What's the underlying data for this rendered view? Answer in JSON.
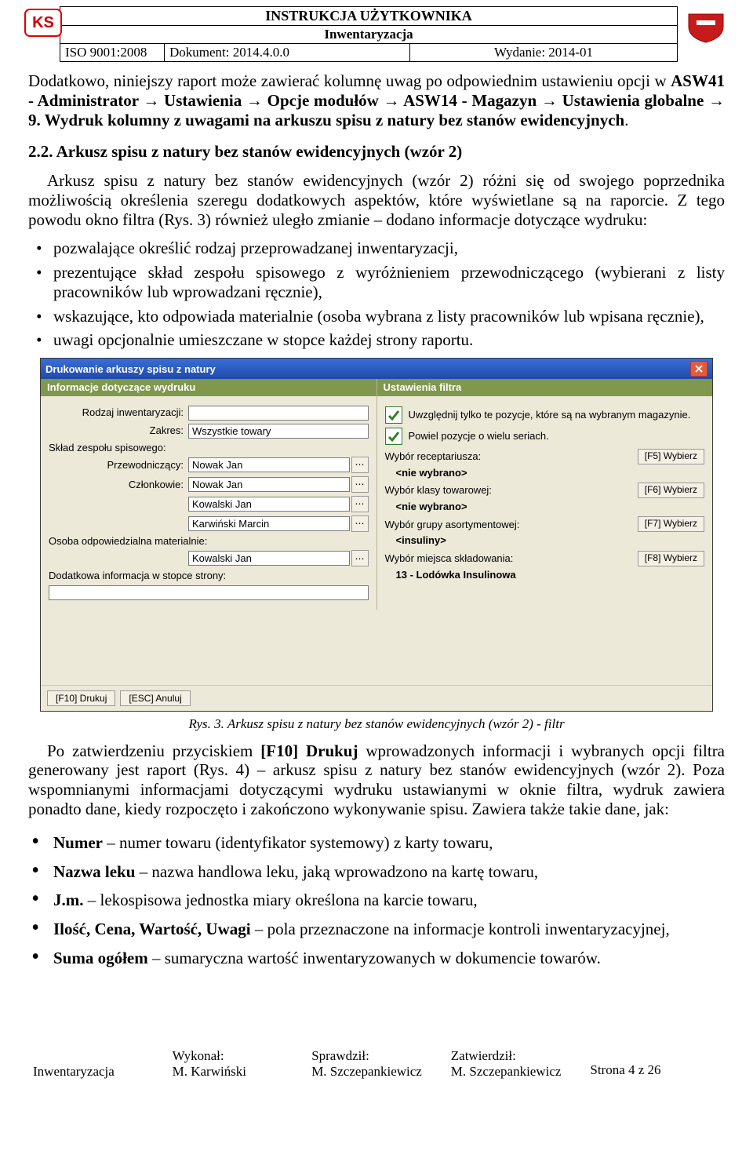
{
  "header": {
    "title": "INSTRUKCJA UŻYTKOWNIKA",
    "subtitle": "Inwentaryzacja",
    "iso": "ISO 9001:2008",
    "doc": "Dokument: 2014.4.0.0",
    "wyd": "Wydanie: 2014-01"
  },
  "p1": "Dodatkowo, niniejszy raport może zawierać kolumnę uwag po odpowiednim ustawieniu opcji w ",
  "p1b1": "ASW41 - Administrator → Ustawienia → Opcje modułów → ASW14 - Magazyn → Ustawienia globalne → 9. Wydruk kolumny z uwagami na arkuszu spisu z natury bez stanów ewidencyjnych",
  "p1e": ".",
  "s22": "2.2. Arkusz spisu z natury bez stanów ewidencyjnych (wzór 2)",
  "p2": "Arkusz spisu z natury bez stanów ewidencyjnych (wzór 2) różni się od swojego poprzednika możliwością określenia szeregu dodatkowych aspektów, które wyświetlane są na raporcie. Z tego powodu okno filtra (Rys. 3) również uległo zmianie – dodano informacje dotyczące wydruku:",
  "b1": "pozwalające określić rodzaj przeprowadzanej inwentaryzacji,",
  "b2": "prezentujące skład zespołu spisowego z wyróżnieniem przewodniczącego (wybierani z listy pracowników lub wprowadzani ręcznie),",
  "b3": "wskazujące, kto odpowiada materialnie (osoba wybrana z listy pracowników lub wpisana ręcznie),",
  "b4": "uwagi opcjonalnie umieszczane w stopce każdej strony raportu.",
  "dlg": {
    "title": "Drukowanie arkuszy spisu z natury",
    "colL": "Informacje dotyczące wydruku",
    "colR": "Ustawienia filtra",
    "rodzaj_l": "Rodzaj inwentaryzacji:",
    "rodzaj_v": "",
    "zakres_l": "Zakres:",
    "zakres_v": "Wszystkie towary",
    "sklad_l": "Skład zespołu spisowego:",
    "przew_l": "Przewodniczący:",
    "przew_v": "Nowak Jan",
    "czlon_l": "Członkowie:",
    "cz1": "Nowak Jan",
    "cz2": "Kowalski Jan",
    "cz3": "Karwiński Marcin",
    "osoba_l": "Osoba odpowiedzialna materialnie:",
    "osoba_v": "Kowalski Jan",
    "dod_l": "Dodatkowa informacja w stopce strony:",
    "dod_v": "",
    "chk1": "Uwzględnij tylko te pozycje, które są na wybranym magazynie.",
    "chk2": "Powiel pozycje o wielu seriach.",
    "wr_l": "Wybór receptariusza:",
    "wr_b": "[F5] Wybierz",
    "wr_v": "<nie wybrano>",
    "wk_l": "Wybór klasy towarowej:",
    "wk_b": "[F6] Wybierz",
    "wk_v": "<nie wybrano>",
    "wg_l": "Wybór grupy asortymentowej:",
    "wg_b": "[F7] Wybierz",
    "wg_v": "<insuliny>",
    "wm_l": "Wybór miejsca składowania:",
    "wm_b": "[F8] Wybierz",
    "wm_v": "13 - Lodówka Insulinowa",
    "bt1": "[F10] Drukuj",
    "bt2": "[ESC] Anuluj"
  },
  "cap": "Rys. 3. Arkusz spisu z natury bez stanów ewidencyjnych (wzór 2) - filtr",
  "p3a": "Po zatwierdzeniu przyciskiem ",
  "p3b": "[F10] Drukuj",
  "p3c": " wprowadzonych informacji i wybranych opcji filtra generowany jest raport (Rys. 4) – arkusz spisu z natury bez stanów ewidencyjnych (wzór 2). Poza wspomnianymi informacjami dotyczącymi wydruku ustawianymi w oknie filtra, wydruk zawiera ponadto dane, kiedy rozpoczęto i zakończono wykonywanie spisu. Zawiera także takie dane, jak:",
  "d1a": "Numer",
  "d1b": " – numer towaru (identyfikator systemowy) z karty towaru,",
  "d2a": "Nazwa leku",
  "d2b": " – nazwa handlowa leku, jaką wprowadzono na kartę towaru,",
  "d3a": "J.m.",
  "d3b": " – lekospisowa jednostka miary określona na karcie towaru,",
  "d4a": "Ilość, Cena, Wartość, Uwagi",
  "d4b": " – pola przeznaczone na informacje kontroli inwentaryzacyjnej,",
  "d5a": "Suma ogółem",
  "d5b": " – sumaryczna wartość inwentaryzowanych w dokumencie towarów.",
  "footer": {
    "c1": "Inwentaryzacja",
    "c2a": "Wykonał:",
    "c2b": "M. Karwiński",
    "c3a": "Sprawdził:",
    "c3b": "M. Szczepankiewicz",
    "c4a": "Zatwierdził:",
    "c4b": "M. Szczepankiewicz",
    "pg": "Strona 4 z 26"
  }
}
